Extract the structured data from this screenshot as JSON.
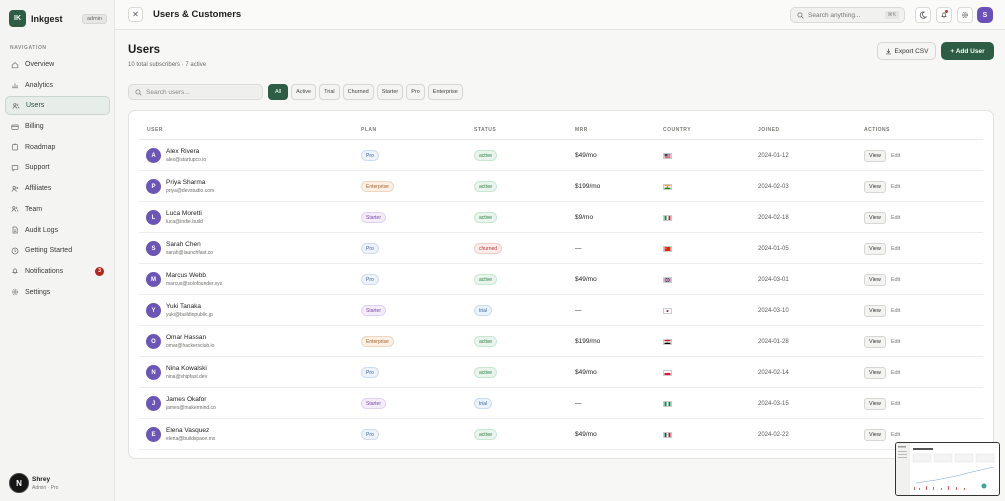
{
  "sidebar": {
    "brand": {
      "logo": "IK",
      "name": "Inkgest",
      "badge": "admin"
    },
    "nav_heading": "NAVIGATION",
    "items": [
      {
        "label": "Overview",
        "icon": "home-icon"
      },
      {
        "label": "Analytics",
        "icon": "bar-chart-icon"
      },
      {
        "label": "Users",
        "icon": "users-icon",
        "active": true
      },
      {
        "label": "Billing",
        "icon": "credit-card-icon"
      },
      {
        "label": "Roadmap",
        "icon": "clipboard-icon"
      },
      {
        "label": "Support",
        "icon": "chat-icon"
      },
      {
        "label": "Affiliates",
        "icon": "user-plus-icon"
      },
      {
        "label": "Team",
        "icon": "team-icon"
      },
      {
        "label": "Audit Logs",
        "icon": "file-icon"
      },
      {
        "label": "Getting Started",
        "icon": "clock-icon"
      },
      {
        "label": "Notifications",
        "icon": "bell-icon",
        "badge": "3"
      },
      {
        "label": "Settings",
        "icon": "gear-icon"
      }
    ],
    "user": {
      "initial": "N",
      "name": "Shrey",
      "role": "Admin · Pro"
    }
  },
  "topbar": {
    "title": "Users & Customers",
    "search_placeholder": "Search anything...",
    "shortcut": "⌘K",
    "avatar_initial": "S"
  },
  "page": {
    "title": "Users",
    "subtitle": "10 total subscribers · 7 active",
    "export_label": "Export CSV",
    "add_label": "+ Add User"
  },
  "filters": {
    "search_placeholder": "Search users...",
    "chips": [
      "All",
      "Active",
      "Trial",
      "Churned",
      "Starter",
      "Pro",
      "Enterprise"
    ]
  },
  "table": {
    "columns": [
      "USER",
      "PLAN",
      "STATUS",
      "MRR",
      "COUNTRY",
      "JOINED",
      "ACTIONS"
    ],
    "view_label": "View",
    "edit_label": "Edit",
    "rows": [
      {
        "initial": "A",
        "name": "Alex Rivera",
        "email": "alex@startupco.io",
        "plan": "Pro",
        "status": "active",
        "mrr": "$49/mo",
        "country": "us",
        "joined": "2024-01-12"
      },
      {
        "initial": "P",
        "name": "Priya Sharma",
        "email": "priya@devstudio.com",
        "plan": "Enterprise",
        "status": "active",
        "mrr": "$199/mo",
        "country": "in",
        "joined": "2024-02-03"
      },
      {
        "initial": "L",
        "name": "Luca Moretti",
        "email": "luca@indie.build",
        "plan": "Starter",
        "status": "active",
        "mrr": "$9/mo",
        "country": "it",
        "joined": "2024-02-18"
      },
      {
        "initial": "S",
        "name": "Sarah Chen",
        "email": "sarah@launchfast.co",
        "plan": "Pro",
        "status": "churned",
        "mrr": "—",
        "country": "cn",
        "joined": "2024-01-05"
      },
      {
        "initial": "M",
        "name": "Marcus Webb",
        "email": "marcus@solofounder.xyz",
        "plan": "Pro",
        "status": "active",
        "mrr": "$49/mo",
        "country": "gb",
        "joined": "2024-03-01"
      },
      {
        "initial": "Y",
        "name": "Yuki Tanaka",
        "email": "yuki@buildinpublic.jp",
        "plan": "Starter",
        "status": "trial",
        "mrr": "—",
        "country": "jp",
        "joined": "2024-03-10"
      },
      {
        "initial": "O",
        "name": "Omar Hassan",
        "email": "omar@hackersclub.io",
        "plan": "Enterprise",
        "status": "active",
        "mrr": "$199/mo",
        "country": "eg",
        "joined": "2024-01-28"
      },
      {
        "initial": "N",
        "name": "Nina Kowalski",
        "email": "nina@shipfast.dev",
        "plan": "Pro",
        "status": "active",
        "mrr": "$49/mo",
        "country": "pl",
        "joined": "2024-02-14"
      },
      {
        "initial": "J",
        "name": "James Okafor",
        "email": "james@makermind.co",
        "plan": "Starter",
        "status": "trial",
        "mrr": "—",
        "country": "ng",
        "joined": "2024-03-15"
      },
      {
        "initial": "E",
        "name": "Elena Vasquez",
        "email": "elena@buildspace.mx",
        "plan": "Pro",
        "status": "active",
        "mrr": "$49/mo",
        "country": "mx",
        "joined": "2024-02-22"
      }
    ]
  },
  "colors": {
    "brand": "#2d5e45",
    "avatar": "#6b55b6",
    "danger": "#b3261e"
  }
}
